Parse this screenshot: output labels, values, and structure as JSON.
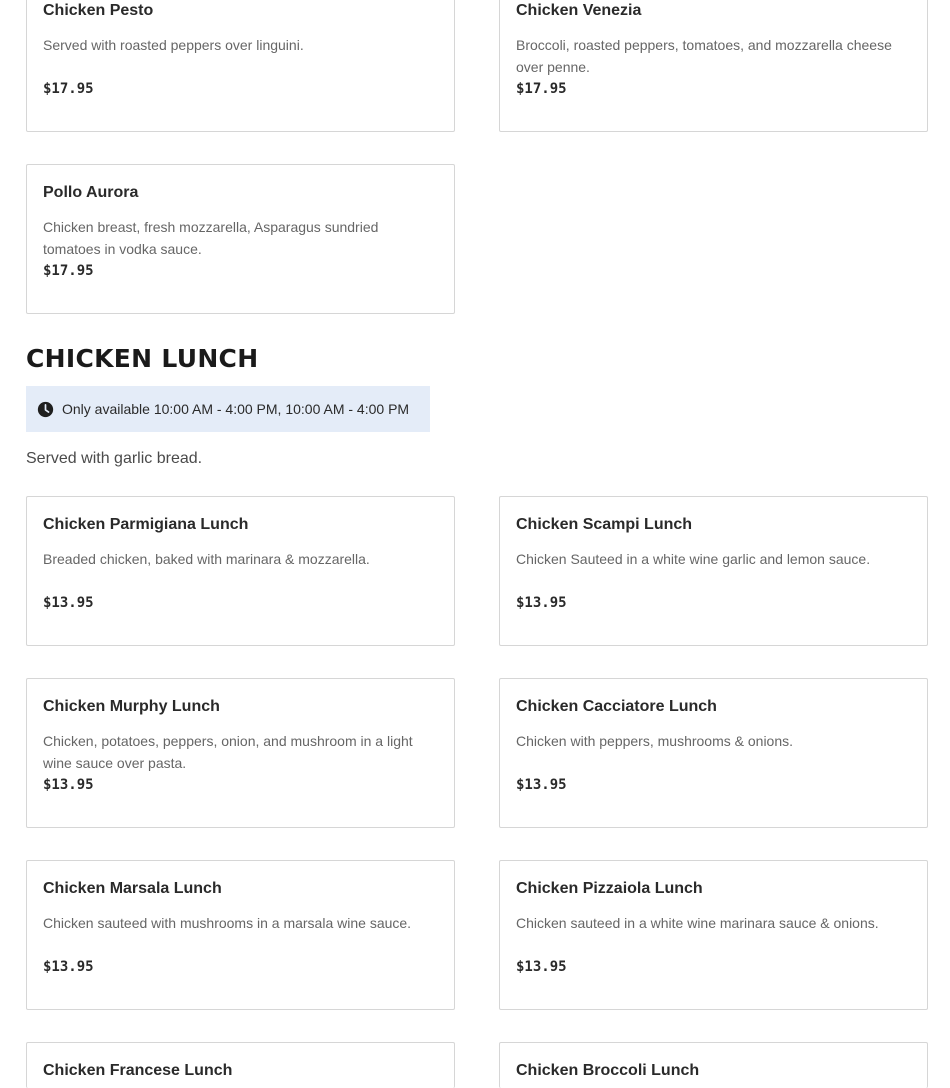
{
  "prev_section": {
    "items": [
      {
        "name": "Chicken Pesto",
        "description": "Served with roasted peppers over linguini.",
        "price": "$17.95"
      },
      {
        "name": "Chicken Venezia",
        "description": "Broccoli, roasted peppers, tomatoes, and mozzarella cheese over penne.",
        "price": "$17.95"
      },
      {
        "name": "Pollo Aurora",
        "description": "Chicken breast, fresh mozzarella, Asparagus sundried tomatoes in vodka sauce.",
        "price": "$17.95"
      }
    ]
  },
  "section": {
    "title": "CHICKEN LUNCH",
    "availability": "Only available 10:00 AM - 4:00 PM, 10:00 AM - 4:00 PM",
    "note": "Served with garlic bread.",
    "icon": "clock-icon",
    "banner_color": "#e4ecf8",
    "items": [
      {
        "name": "Chicken Parmigiana Lunch",
        "description": "Breaded chicken, baked with marinara & mozzarella.",
        "price": "$13.95"
      },
      {
        "name": "Chicken Scampi Lunch",
        "description": "Chicken Sauteed in a white wine garlic and lemon sauce.",
        "price": "$13.95"
      },
      {
        "name": "Chicken Murphy Lunch",
        "description": "Chicken, potatoes, peppers, onion, and mushroom in a light wine sauce over pasta.",
        "price": "$13.95"
      },
      {
        "name": "Chicken Cacciatore Lunch",
        "description": "Chicken with peppers, mushrooms & onions.",
        "price": "$13.95"
      },
      {
        "name": "Chicken Marsala Lunch",
        "description": "Chicken sauteed with mushrooms in a marsala wine sauce.",
        "price": "$13.95"
      },
      {
        "name": "Chicken Pizzaiola Lunch",
        "description": "Chicken sauteed in a white wine marinara sauce & onions.",
        "price": "$13.95"
      },
      {
        "name": "Chicken Francese Lunch",
        "description": "",
        "price": ""
      },
      {
        "name": "Chicken Broccoli Lunch",
        "description": "",
        "price": ""
      }
    ]
  }
}
